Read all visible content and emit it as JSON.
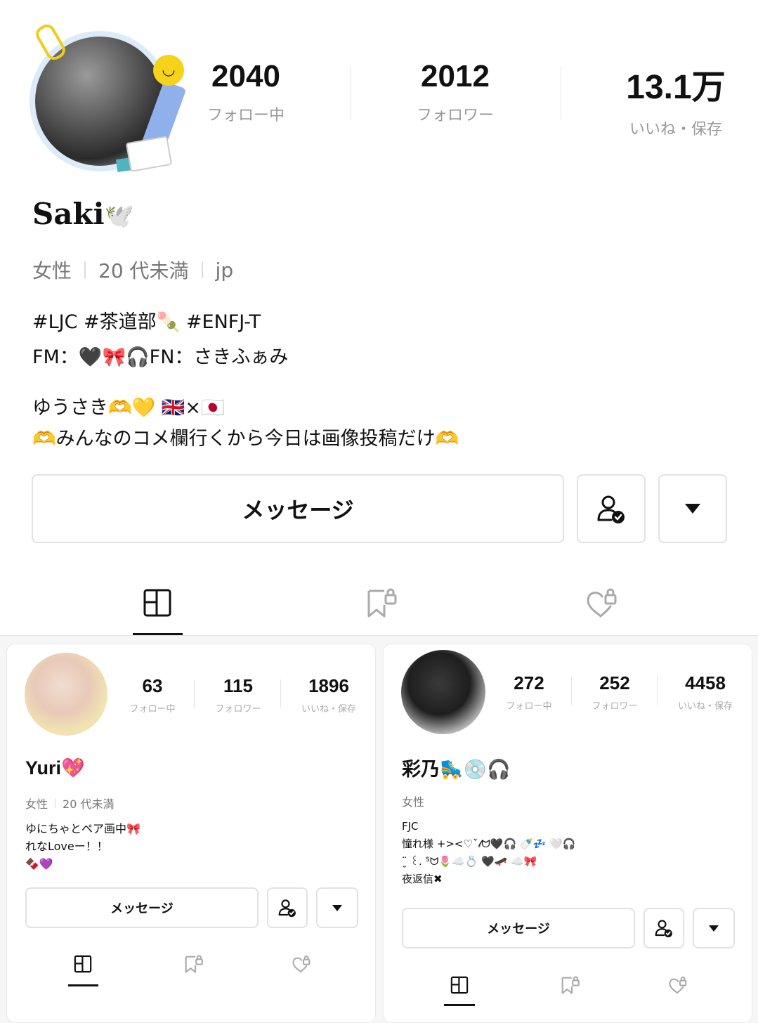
{
  "profile": {
    "name": "Saki",
    "name_emoji": "🕊️",
    "stats": [
      {
        "value": "2040",
        "label": "フォロー中"
      },
      {
        "value": "2012",
        "label": "フォロワー"
      },
      {
        "value": "13.1万",
        "label": "いいね・保存"
      }
    ],
    "meta": [
      "女性",
      "20 代未満",
      "jp"
    ],
    "bio": [
      "#LJC  #茶道部🍡  #ENFJ-T",
      "FM：🖤🎀🎧FN：さきふぁみ",
      "",
      "ゆうさき🫶💛    🇬🇧×🇯🇵",
      "🫶みんなのコメ欄行くから今日は画像投稿だけ🫶"
    ],
    "message_label": "メッセージ"
  },
  "cards": [
    {
      "name": "Yuri💖",
      "stats": [
        {
          "value": "63",
          "label": "フォロー中"
        },
        {
          "value": "115",
          "label": "フォロワー"
        },
        {
          "value": "1896",
          "label": "いいね・保存"
        }
      ],
      "meta": [
        "女性",
        "20 代未満"
      ],
      "bio": [
        "ゆにちゃとペア画中🎀",
        "れなLoveー！！",
        "🍫💜"
      ],
      "message_label": "メッセージ"
    },
    {
      "name": "彩乃🛼💿🎧",
      "stats": [
        {
          "value": "272",
          "label": "フォロー中"
        },
        {
          "value": "252",
          "label": "フォロワー"
        },
        {
          "value": "4458",
          "label": "いいね・保存"
        }
      ],
      "meta": [
        "女性"
      ],
      "bio": [
        "FJC",
        "憧れ様 +><♡ˇ𝓁ᗢ🖤🎧    🍼💤   🤍🎧",
        "¨̮ ꒰. ᔆᗢ🌷☁️💍 🖤🛹    ☁️🎀",
        "夜返信✖"
      ],
      "message_label": "メッセージ"
    }
  ],
  "icons": {
    "follow_status": "person-check-icon",
    "dropdown": "caret-down-icon",
    "tab_posts": "grid-icon",
    "tab_saved": "bookmark-lock-icon",
    "tab_liked": "heart-lock-icon"
  }
}
